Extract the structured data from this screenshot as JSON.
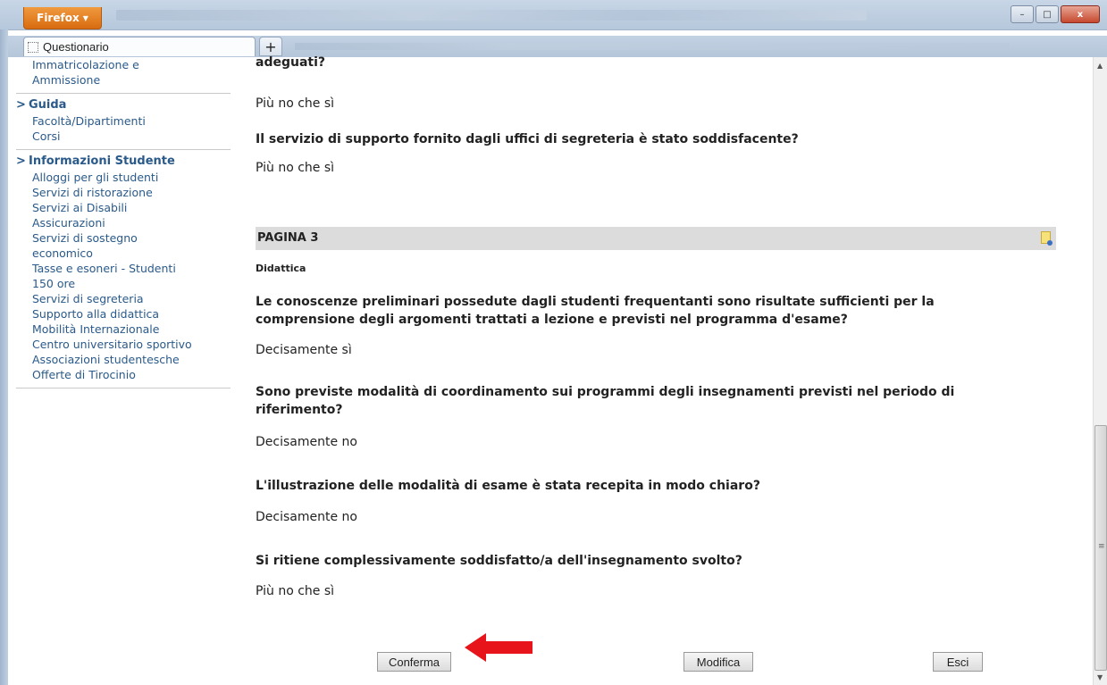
{
  "browser": {
    "menu_label": "Firefox",
    "menu_caret": "▼",
    "tab_title": "Questionario",
    "new_tab": "+",
    "window_controls": {
      "minimize": "–",
      "maximize": "□",
      "close": "x"
    }
  },
  "sidebar": {
    "top_items": [
      "Immatricolazione e Ammissione"
    ],
    "sections": [
      {
        "title": "Guida",
        "items": [
          "Facoltà/Dipartimenti",
          "Corsi"
        ]
      },
      {
        "title": "Informazioni Studente",
        "items": [
          "Alloggi per gli studenti",
          "Servizi di ristorazione",
          "Servizi ai Disabili",
          "Assicurazioni",
          "Servizi di sostegno economico",
          "Tasse e esoneri - Studenti 150 ore",
          "Servizi di segreteria",
          "Supporto alla didattica",
          "Mobilità Internazionale",
          "Centro universitario sportivo",
          "Associazioni studentesche",
          "Offerte di Tirocinio"
        ]
      }
    ]
  },
  "main": {
    "q0_tail": "adeguati?",
    "a0": "Più no che sì",
    "q1": "Il servizio di supporto fornito dagli uffici di segreteria è stato soddisfacente?",
    "a1": "Più no che sì",
    "page_header": "PAGINA 3",
    "section": "Didattica",
    "q2": "Le conoscenze preliminari possedute dagli studenti frequentanti sono risultate sufficienti per la comprensione degli argomenti trattati a lezione e previsti nel programma d'esame?",
    "a2": "Decisamente sì",
    "q3": "Sono previste modalità di coordinamento sui programmi degli insegnamenti previsti nel periodo di riferimento?",
    "a3": "Decisamente no",
    "q4": "L'illustrazione delle modalità di esame è stata recepita in modo chiaro?",
    "a4": "Decisamente no",
    "q5": "Si ritiene complessivamente soddisfatto/a dell'insegnamento svolto?",
    "a5": "Più no che sì"
  },
  "buttons": {
    "confirm": "Conferma",
    "edit": "Modifica",
    "exit": "Esci"
  },
  "colors": {
    "arrow": "#e8141b",
    "sidebar_link": "#2a5a8a",
    "page_header_bg": "#dcdcdc"
  }
}
